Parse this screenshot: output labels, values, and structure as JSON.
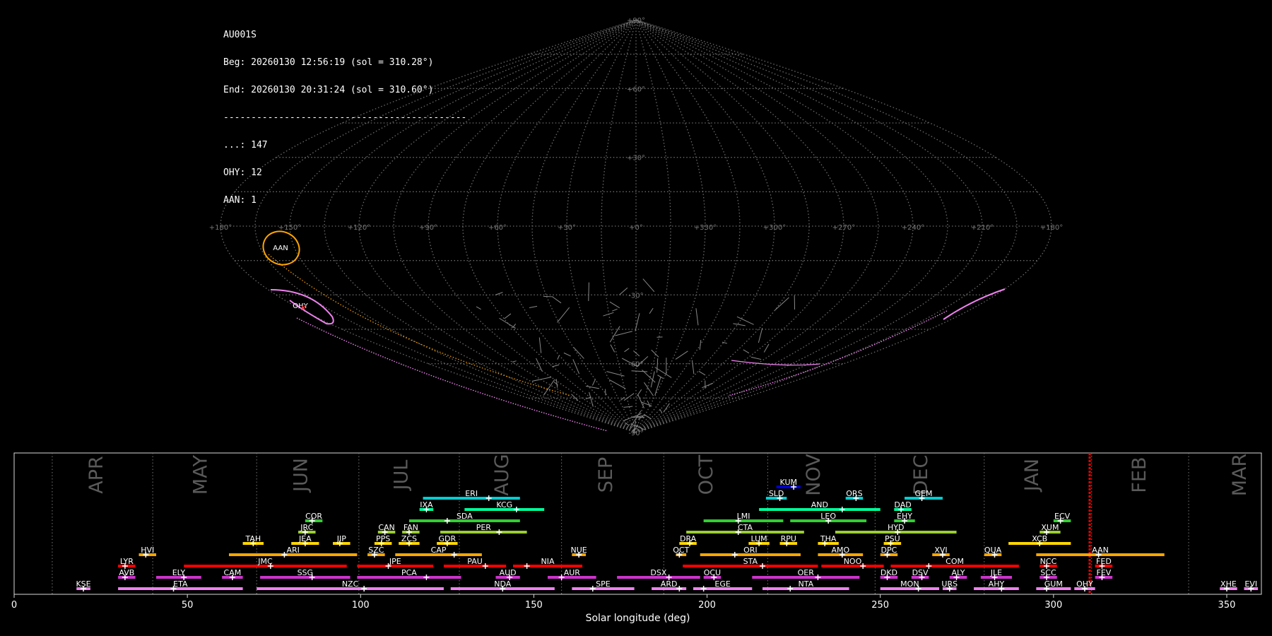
{
  "info": {
    "station": "AU001S",
    "beg": "Beg: 20260130 12:56:19 (sol = 310.28°)",
    "end": "End: 20260130 20:31:24 (sol = 310.60°)",
    "separator": "--------------------------------------------",
    "counts": [
      "...: 147",
      "OHY: 12",
      "AAN: 1"
    ]
  },
  "sky_map": {
    "lat_labels": [
      "+90°",
      "+60°",
      "+30°",
      "-30°",
      "-60°",
      "-90°"
    ],
    "lon_labels": [
      "+180°",
      "+150°",
      "+120°",
      "+90°",
      "+60°",
      "+30°",
      "+0°",
      "+330°",
      "+300°",
      "+270°",
      "+240°",
      "+210°",
      "+180°"
    ],
    "radiants": [
      {
        "code": "AAN",
        "color": "#ffa500"
      },
      {
        "code": "OHY",
        "color": "#ee82ee"
      }
    ]
  },
  "chart_data": {
    "type": "bar",
    "title": "",
    "xlabel": "Solar longitude (deg)",
    "ylabel": "",
    "xlim": [
      0,
      360
    ],
    "xticks": [
      0,
      50,
      100,
      150,
      200,
      250,
      300,
      350
    ],
    "grid": false,
    "months": [
      {
        "name": "APR",
        "start": 11,
        "label_at": 24
      },
      {
        "name": "MAY",
        "start": 40,
        "label_at": 54
      },
      {
        "name": "JUN",
        "start": 70,
        "label_at": 83
      },
      {
        "name": "JUL",
        "start": 99.5,
        "label_at": 112
      },
      {
        "name": "AUG",
        "start": 128.5,
        "label_at": 141
      },
      {
        "name": "SEP",
        "start": 158,
        "label_at": 171
      },
      {
        "name": "OCT",
        "start": 187.5,
        "label_at": 200
      },
      {
        "name": "NOV",
        "start": 217.5,
        "label_at": 231
      },
      {
        "name": "DEC",
        "start": 248.5,
        "label_at": 262
      },
      {
        "name": "JAN",
        "start": 280,
        "label_at": 294
      },
      {
        "name": "FEB",
        "start": 311,
        "label_at": 325
      },
      {
        "name": "MAR",
        "start": 339,
        "label_at": 354
      }
    ],
    "current_sol": [
      310.28,
      310.6
    ],
    "showers": [
      {
        "code": "KUM",
        "start": 220,
        "end": 227,
        "peak": 225,
        "row": 9,
        "color": "#0000cd"
      },
      {
        "code": "ERI",
        "start": 118,
        "end": 146,
        "peak": 137,
        "row": 8,
        "color": "#00ced1"
      },
      {
        "code": "SLD",
        "start": 217,
        "end": 223,
        "peak": 221,
        "row": 8,
        "color": "#00ced1"
      },
      {
        "code": "ORS",
        "start": 240,
        "end": 245,
        "peak": 243,
        "row": 8,
        "color": "#00ced1"
      },
      {
        "code": "GEM",
        "start": 257,
        "end": 268,
        "peak": 262,
        "row": 8,
        "color": "#00ced1"
      },
      {
        "code": "IXA",
        "start": 117,
        "end": 121,
        "peak": 119,
        "row": 7,
        "color": "#00fa9a"
      },
      {
        "code": "KCG",
        "start": 130,
        "end": 153,
        "peak": 145,
        "row": 7,
        "color": "#00fa9a"
      },
      {
        "code": "AND",
        "start": 215,
        "end": 250,
        "peak": 239,
        "row": 7,
        "color": "#00fa9a"
      },
      {
        "code": "DAD",
        "start": 254,
        "end": 259,
        "peak": 256,
        "row": 7,
        "color": "#00fa9a"
      },
      {
        "code": "COR",
        "start": 84,
        "end": 89,
        "peak": 86,
        "row": 6,
        "color": "#32cd32"
      },
      {
        "code": "SDA",
        "start": 114,
        "end": 146,
        "peak": 125,
        "row": 6,
        "color": "#32cd32"
      },
      {
        "code": "LMI",
        "start": 199,
        "end": 222,
        "peak": 209,
        "row": 6,
        "color": "#32cd32"
      },
      {
        "code": "LEO",
        "start": 224,
        "end": 246,
        "peak": 235,
        "row": 6,
        "color": "#32cd32"
      },
      {
        "code": "EHY",
        "start": 254,
        "end": 260,
        "peak": 257,
        "row": 6,
        "color": "#32cd32"
      },
      {
        "code": "ECV",
        "start": 300,
        "end": 305,
        "peak": 302,
        "row": 6,
        "color": "#32cd32"
      },
      {
        "code": "JRC",
        "start": 82,
        "end": 87,
        "peak": 84,
        "row": 5,
        "color": "#9acd32"
      },
      {
        "code": "CAN",
        "start": 105,
        "end": 110,
        "peak": 107,
        "row": 5,
        "color": "#9acd32"
      },
      {
        "code": "FAN",
        "start": 112,
        "end": 117,
        "peak": 114,
        "row": 5,
        "color": "#9acd32"
      },
      {
        "code": "PER",
        "start": 123,
        "end": 148,
        "peak": 140,
        "row": 5,
        "color": "#9acd32"
      },
      {
        "code": "CTA",
        "start": 194,
        "end": 228,
        "peak": 209,
        "row": 5,
        "color": "#9acd32"
      },
      {
        "code": "HYD",
        "start": 237,
        "end": 272,
        "peak": 255,
        "row": 5,
        "color": "#9acd32"
      },
      {
        "code": "XUM",
        "start": 296,
        "end": 302,
        "peak": 298,
        "row": 5,
        "color": "#9acd32"
      },
      {
        "code": "TAH",
        "start": 66,
        "end": 72,
        "peak": 69,
        "row": 4,
        "color": "#ffd700"
      },
      {
        "code": "JEA",
        "start": 80,
        "end": 88,
        "peak": 84,
        "row": 4,
        "color": "#ffd700"
      },
      {
        "code": "JIP",
        "start": 92,
        "end": 97,
        "peak": 94,
        "row": 4,
        "color": "#ffd700"
      },
      {
        "code": "PPS",
        "start": 104,
        "end": 109,
        "peak": 106,
        "row": 4,
        "color": "#ffd700"
      },
      {
        "code": "ZCS",
        "start": 111,
        "end": 117,
        "peak": 114,
        "row": 4,
        "color": "#ffd700"
      },
      {
        "code": "GDR",
        "start": 122,
        "end": 128,
        "peak": 125,
        "row": 4,
        "color": "#ffd700"
      },
      {
        "code": "DRA",
        "start": 192,
        "end": 197,
        "peak": 195,
        "row": 4,
        "color": "#ffd700"
      },
      {
        "code": "LUM",
        "start": 212,
        "end": 218,
        "peak": 215,
        "row": 4,
        "color": "#ffd700"
      },
      {
        "code": "RPU",
        "start": 221,
        "end": 226,
        "peak": 223,
        "row": 4,
        "color": "#ffd700"
      },
      {
        "code": "THA",
        "start": 232,
        "end": 238,
        "peak": 234,
        "row": 4,
        "color": "#ffd700"
      },
      {
        "code": "PSU",
        "start": 251,
        "end": 256,
        "peak": 253,
        "row": 4,
        "color": "#ffd700"
      },
      {
        "code": "XCB",
        "start": 287,
        "end": 305,
        "peak": 296,
        "row": 4,
        "color": "#ffd700"
      },
      {
        "code": "HVI",
        "start": 36,
        "end": 41,
        "peak": 38,
        "row": 3,
        "color": "#ffa500"
      },
      {
        "code": "ARI",
        "start": 62,
        "end": 99,
        "peak": 78,
        "row": 3,
        "color": "#ffa500"
      },
      {
        "code": "SZC",
        "start": 102,
        "end": 107,
        "peak": 104,
        "row": 3,
        "color": "#ffa500"
      },
      {
        "code": "CAP",
        "start": 110,
        "end": 135,
        "peak": 127,
        "row": 3,
        "color": "#ffa500"
      },
      {
        "code": "NUE",
        "start": 161,
        "end": 165,
        "peak": 163,
        "row": 3,
        "color": "#ffa500"
      },
      {
        "code": "OCT",
        "start": 191,
        "end": 194,
        "peak": 192,
        "row": 3,
        "color": "#ffa500"
      },
      {
        "code": "ORI",
        "start": 198,
        "end": 227,
        "peak": 208,
        "row": 3,
        "color": "#ffa500"
      },
      {
        "code": "AMO",
        "start": 232,
        "end": 245,
        "peak": 239,
        "row": 3,
        "color": "#ffa500"
      },
      {
        "code": "DPC",
        "start": 250,
        "end": 255,
        "peak": 252,
        "row": 3,
        "color": "#ffa500"
      },
      {
        "code": "XVI",
        "start": 265,
        "end": 270,
        "peak": 268,
        "row": 3,
        "color": "#ffa500"
      },
      {
        "code": "QUA",
        "start": 280,
        "end": 285,
        "peak": 283,
        "row": 3,
        "color": "#ffa500"
      },
      {
        "code": "AAN",
        "start": 295,
        "end": 332,
        "peak": 313,
        "row": 3,
        "color": "#ffa500"
      },
      {
        "code": "LYR",
        "start": 30,
        "end": 35,
        "peak": 32,
        "row": 2,
        "color": "#ff0000"
      },
      {
        "code": "JMC",
        "start": 49,
        "end": 96,
        "peak": 74,
        "row": 2,
        "color": "#ff0000"
      },
      {
        "code": "JPE",
        "start": 99,
        "end": 121,
        "peak": 108,
        "row": 2,
        "color": "#ff0000"
      },
      {
        "code": "PAU",
        "start": 124,
        "end": 142,
        "peak": 136,
        "row": 2,
        "color": "#ff0000"
      },
      {
        "code": "NIA",
        "start": 144,
        "end": 164,
        "peak": 148,
        "row": 2,
        "color": "#ff0000"
      },
      {
        "code": "STA",
        "start": 193,
        "end": 232,
        "peak": 216,
        "row": 2,
        "color": "#ff0000"
      },
      {
        "code": "NOO",
        "start": 233,
        "end": 251,
        "peak": 245,
        "row": 2,
        "color": "#ff0000"
      },
      {
        "code": "COM",
        "start": 253,
        "end": 290,
        "peak": 264,
        "row": 2,
        "color": "#ff0000"
      },
      {
        "code": "NCC",
        "start": 296,
        "end": 301,
        "peak": 298,
        "row": 2,
        "color": "#ff0000"
      },
      {
        "code": "FED",
        "start": 312,
        "end": 317,
        "peak": 314,
        "row": 2,
        "color": "#ff0000"
      },
      {
        "code": "AVB",
        "start": 30,
        "end": 35,
        "peak": 32,
        "row": 1,
        "color": "#cc33cc"
      },
      {
        "code": "ELY",
        "start": 41,
        "end": 54,
        "peak": 49,
        "row": 1,
        "color": "#cc33cc"
      },
      {
        "code": "CAM",
        "start": 60,
        "end": 66,
        "peak": 63,
        "row": 1,
        "color": "#cc33cc"
      },
      {
        "code": "SSG",
        "start": 71,
        "end": 97,
        "peak": 86,
        "row": 1,
        "color": "#cc33cc"
      },
      {
        "code": "PCA",
        "start": 99,
        "end": 129,
        "peak": 119,
        "row": 1,
        "color": "#cc33cc"
      },
      {
        "code": "AUD",
        "start": 139,
        "end": 146,
        "peak": 143,
        "row": 1,
        "color": "#cc33cc"
      },
      {
        "code": "AUR",
        "start": 154,
        "end": 168,
        "peak": 158,
        "row": 1,
        "color": "#cc33cc"
      },
      {
        "code": "DSX",
        "start": 174,
        "end": 198,
        "peak": 189,
        "row": 1,
        "color": "#cc33cc"
      },
      {
        "code": "OCU",
        "start": 199,
        "end": 204,
        "peak": 202,
        "row": 1,
        "color": "#cc33cc"
      },
      {
        "code": "OER",
        "start": 213,
        "end": 244,
        "peak": 232,
        "row": 1,
        "color": "#cc33cc"
      },
      {
        "code": "DKD",
        "start": 250,
        "end": 255,
        "peak": 252,
        "row": 1,
        "color": "#cc33cc"
      },
      {
        "code": "DSV",
        "start": 259,
        "end": 264,
        "peak": 262,
        "row": 1,
        "color": "#cc33cc"
      },
      {
        "code": "ALY",
        "start": 270,
        "end": 275,
        "peak": 272,
        "row": 1,
        "color": "#cc33cc"
      },
      {
        "code": "JLE",
        "start": 279,
        "end": 288,
        "peak": 283,
        "row": 1,
        "color": "#cc33cc"
      },
      {
        "code": "SCC",
        "start": 296,
        "end": 301,
        "peak": 298,
        "row": 1,
        "color": "#cc33cc"
      },
      {
        "code": "FEV",
        "start": 312,
        "end": 317,
        "peak": 314,
        "row": 1,
        "color": "#cc33cc"
      },
      {
        "code": "KSE",
        "start": 18,
        "end": 22,
        "peak": 20,
        "row": 0,
        "color": "#ee82ee"
      },
      {
        "code": "ETA",
        "start": 30,
        "end": 66,
        "peak": 46,
        "row": 0,
        "color": "#ee82ee"
      },
      {
        "code": "NZC",
        "start": 70,
        "end": 124,
        "peak": 101,
        "row": 0,
        "color": "#ee82ee"
      },
      {
        "code": "NDA",
        "start": 126,
        "end": 156,
        "peak": 141,
        "row": 0,
        "color": "#ee82ee"
      },
      {
        "code": "SPE",
        "start": 161,
        "end": 179,
        "peak": 167,
        "row": 0,
        "color": "#ee82ee"
      },
      {
        "code": "ARD",
        "start": 184,
        "end": 194,
        "peak": 192,
        "row": 0,
        "color": "#ee82ee"
      },
      {
        "code": "EGE",
        "start": 196,
        "end": 213,
        "peak": 199,
        "row": 0,
        "color": "#ee82ee"
      },
      {
        "code": "NTA",
        "start": 216,
        "end": 241,
        "peak": 224,
        "row": 0,
        "color": "#ee82ee"
      },
      {
        "code": "MON",
        "start": 250,
        "end": 267,
        "peak": 261,
        "row": 0,
        "color": "#ee82ee"
      },
      {
        "code": "URS",
        "start": 268,
        "end": 272,
        "peak": 270,
        "row": 0,
        "color": "#ee82ee"
      },
      {
        "code": "AHY",
        "start": 277,
        "end": 290,
        "peak": 285,
        "row": 0,
        "color": "#ee82ee"
      },
      {
        "code": "GUM",
        "start": 295,
        "end": 305,
        "peak": 298,
        "row": 0,
        "color": "#ee82ee"
      },
      {
        "code": "OHY",
        "start": 306,
        "end": 312,
        "peak": 309,
        "row": 0,
        "color": "#ee82ee"
      },
      {
        "code": "XHE",
        "start": 348,
        "end": 353,
        "peak": 350,
        "row": 0,
        "color": "#ee82ee"
      },
      {
        "code": "EVI",
        "start": 355,
        "end": 359,
        "peak": 357,
        "row": 0,
        "color": "#ee82ee"
      }
    ]
  }
}
